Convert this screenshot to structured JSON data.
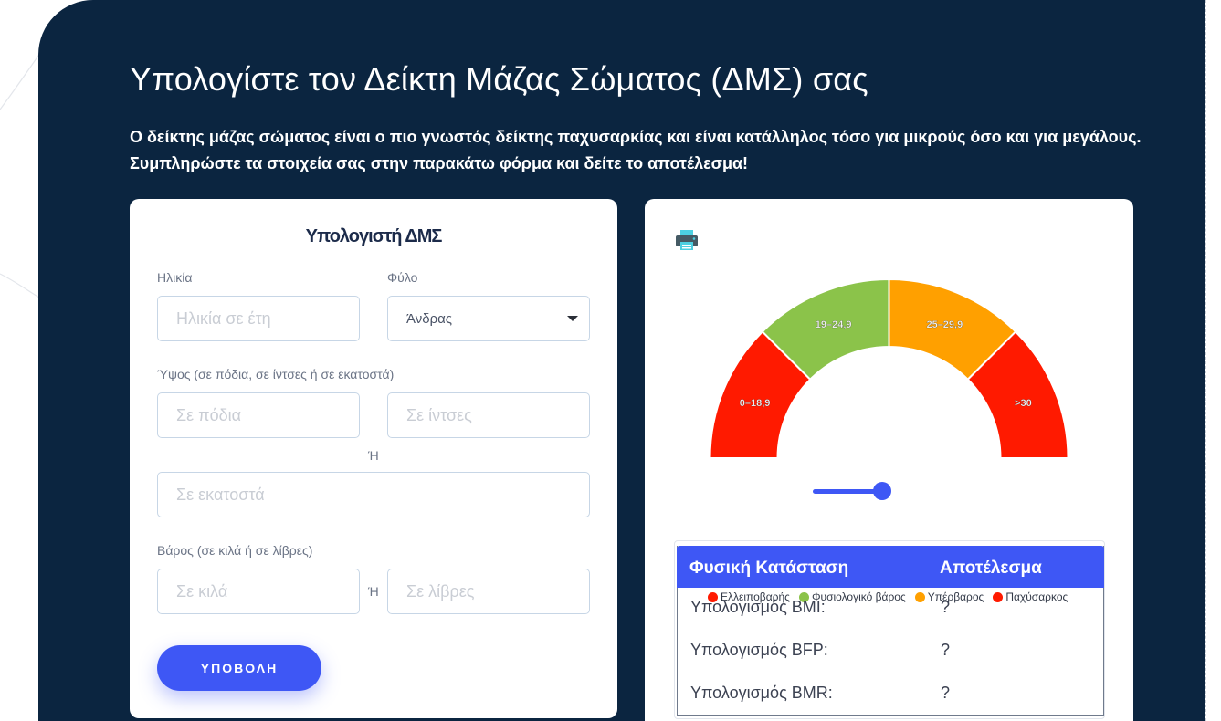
{
  "hero": {
    "title": "Υπολογίστε τον Δείκτη Μάζας Σώματος (ΔΜΣ) σας",
    "intro_line1": "Ο δείκτης μάζας σώματος είναι ο πιο γνωστός δείκτης παχυσαρκίας και είναι κατάλληλος τόσο για μικρούς όσο και για μεγάλους.",
    "intro_line2": "Συμπληρώστε τα στοιχεία σας στην παρακάτω φόρμα και δείτε το αποτέλεσμα!"
  },
  "form": {
    "title": "Υπολογιστή ΔΜΣ",
    "age_label": "Ηλικία",
    "age_placeholder": "Ηλικία σε έτη",
    "sex_label": "Φύλο",
    "sex_value": "Άνδρας",
    "height_label": "Ύψος (σε πόδια, σε ίντσες ή σε εκατοστά)",
    "feet_placeholder": "Σε πόδια",
    "inches_placeholder": "Σε ίντσες",
    "or_label": "Ή",
    "cm_placeholder": "Σε εκατοστά",
    "weight_label": "Βάρος (σε κιλά ή σε λίβρες)",
    "kg_placeholder": "Σε κιλά",
    "or_label_2": "Ή",
    "lb_placeholder": "Σε λίβρες",
    "submit_label": "ΥΠΟΒΟΛΗ"
  },
  "gauge": {
    "segments": [
      {
        "label": "0–18,9",
        "color": "#ff1a00"
      },
      {
        "label": "19–24,9",
        "color": "#8bc34a"
      },
      {
        "label": "25–29,9",
        "color": "#ffa000"
      },
      {
        "label": ">30",
        "color": "#ff1a00"
      }
    ],
    "icon": "printer-icon"
  },
  "results": {
    "col_state": "Φυσική Κατάσταση",
    "col_result": "Αποτέλεσμα",
    "legend": [
      {
        "label": "Ελλειποβαρής",
        "color": "#ff1a00"
      },
      {
        "label": "Φυσιολογικό βάρος",
        "color": "#8bc34a"
      },
      {
        "label": "Υπέρβαρος",
        "color": "#ffa000"
      },
      {
        "label": "Παχύσαρκος",
        "color": "#ff1a00"
      }
    ],
    "rows": [
      {
        "label": "Υπολογισμός BMI:",
        "value": "?"
      },
      {
        "label": "Υπολογισμός BFP:",
        "value": "?"
      },
      {
        "label": "Υπολογισμός BMR:",
        "value": "?"
      }
    ]
  },
  "colors": {
    "hero_bg": "#0b2540",
    "accent": "#3e57f5"
  }
}
